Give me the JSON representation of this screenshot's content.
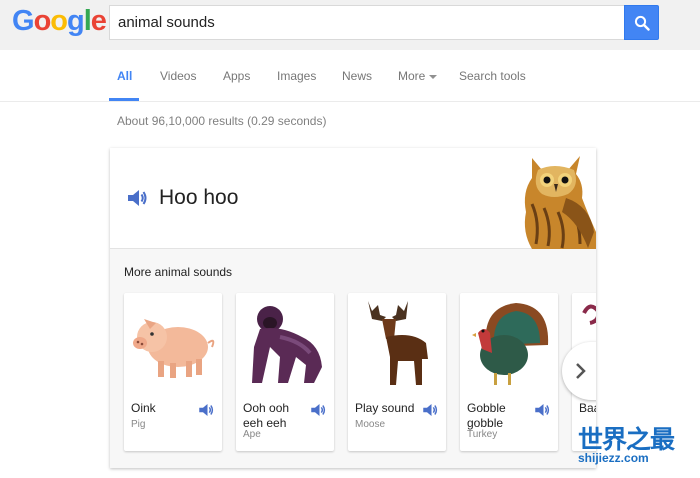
{
  "logo": {
    "text": "Google",
    "letters": [
      "G",
      "o",
      "o",
      "g",
      "l",
      "e"
    ],
    "colors": [
      "#4285f4",
      "#ea4335",
      "#fbbc05",
      "#4285f4",
      "#34a853",
      "#ea4335"
    ]
  },
  "search": {
    "query": "animal sounds",
    "button_icon": "search-icon"
  },
  "tabs": [
    {
      "label": "All",
      "active": true
    },
    {
      "label": "Videos",
      "active": false
    },
    {
      "label": "Apps",
      "active": false
    },
    {
      "label": "Images",
      "active": false
    },
    {
      "label": "News",
      "active": false
    },
    {
      "label": "More",
      "active": false
    },
    {
      "label": "Search tools",
      "active": false
    }
  ],
  "result_stats": "About 96,10,000 results (0.29 seconds)",
  "featured": {
    "sound": "Hoo hoo",
    "animal_icon": "owl-image",
    "speaker_icon": "speaker-icon"
  },
  "more": {
    "title": "More animal sounds",
    "items": [
      {
        "sound": "Oink",
        "animal": "Pig",
        "icon": "pig-image"
      },
      {
        "sound": "Ooh ooh eeh eeh",
        "animal": "Ape",
        "icon": "gorilla-image"
      },
      {
        "sound": "Play sound",
        "animal": "Moose",
        "icon": "moose-image"
      },
      {
        "sound": "Gobble gobble",
        "animal": "Turkey",
        "icon": "turkey-image"
      },
      {
        "sound": "Baa",
        "animal": "",
        "icon": "sheep-image"
      }
    ],
    "next_icon": "chevron-right-icon"
  },
  "watermark": {
    "big": "世界之最",
    "small": "shijiezz.com"
  },
  "colors": {
    "accent": "#4285f4",
    "speaker": "#4a6fc9"
  }
}
